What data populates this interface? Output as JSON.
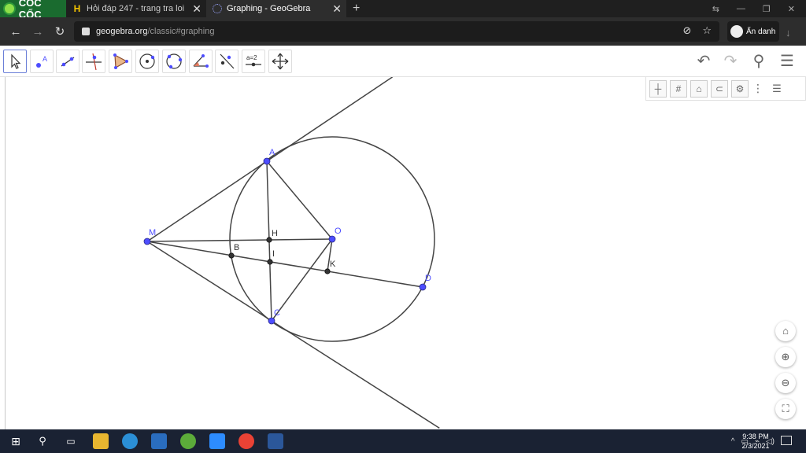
{
  "browser": {
    "brand": "CỐC CỐC",
    "tabs": [
      {
        "title": "Hỏi đáp 247 - trang tra loi",
        "icon": "h-favicon-icon"
      },
      {
        "title": "Graphing - GeoGebra",
        "icon": "geogebra-favicon-icon"
      }
    ],
    "new_tab": "+",
    "url_host": "geogebra.org",
    "url_path": "/classic#graphing",
    "incognito_label": "Ẩn danh"
  },
  "toolbar": {
    "tools": [
      "move-tool",
      "point-tool",
      "line-tool",
      "perpendicular-line-tool",
      "polygon-tool",
      "circle-center-point-tool",
      "circle-three-points-tool",
      "angle-tool",
      "reflect-tool",
      "slider-tool",
      "move-graphics-view-tool"
    ],
    "slider_label": "a=2"
  },
  "geometry": {
    "points": [
      {
        "id": "A",
        "label": "A"
      },
      {
        "id": "M",
        "label": "M"
      },
      {
        "id": "H",
        "label": "H"
      },
      {
        "id": "O",
        "label": "O"
      },
      {
        "id": "B",
        "label": "B"
      },
      {
        "id": "I",
        "label": "I"
      },
      {
        "id": "K",
        "label": "K"
      },
      {
        "id": "D",
        "label": "D"
      },
      {
        "id": "C",
        "label": "C"
      }
    ],
    "colors": {
      "free_point": "#4d4dff",
      "dependent_point": "#333333",
      "line": "#444444",
      "label_free": "#4d4dff",
      "label_dep": "#333333"
    }
  },
  "taskbar": {
    "time": "9:38 PM",
    "date": "2/3/2021"
  }
}
